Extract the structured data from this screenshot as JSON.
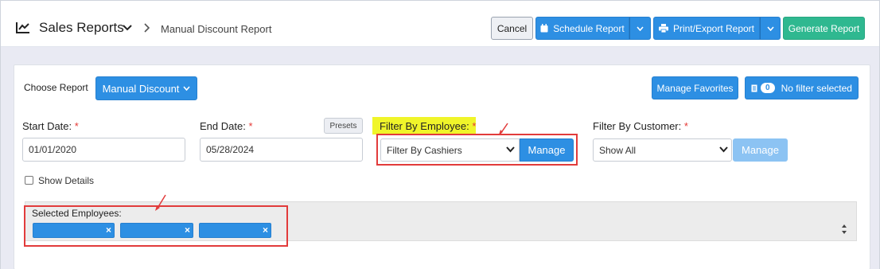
{
  "header": {
    "title": "Sales Reports",
    "breadcrumb_current": "Manual Discount Report",
    "buttons": {
      "cancel": "Cancel",
      "schedule": "Schedule Report",
      "print": "Print/Export Report",
      "generate": "Generate Report"
    }
  },
  "toolbar": {
    "choose_label": "Choose Report",
    "report_select": "Manual Discount",
    "manage_favorites": "Manage Favorites",
    "filter_count": "0",
    "filter_text": "No filter selected"
  },
  "filters": {
    "start_date": {
      "label": "Start Date:",
      "required": "*",
      "value": "01/01/2020"
    },
    "end_date": {
      "label": "End Date:",
      "required": "*",
      "value": "05/28/2024",
      "presets": "Presets"
    },
    "employee": {
      "label": "Filter By Employee:",
      "required": "*",
      "selected": "Filter By Cashiers",
      "manage": "Manage"
    },
    "customer": {
      "label": "Filter By Customer:",
      "required": "*",
      "selected": "Show All",
      "manage": "Manage"
    }
  },
  "show_details": {
    "label": "Show Details",
    "checked": false
  },
  "selected_employees": {
    "label": "Selected Employees:",
    "chips": [
      {
        "remove": "×"
      },
      {
        "remove": "×"
      },
      {
        "remove": "×"
      }
    ]
  },
  "colors": {
    "primary": "#2d8fe3",
    "success": "#2fb890",
    "annotation": "#e23b3b",
    "highlight": "#f0f52a"
  }
}
